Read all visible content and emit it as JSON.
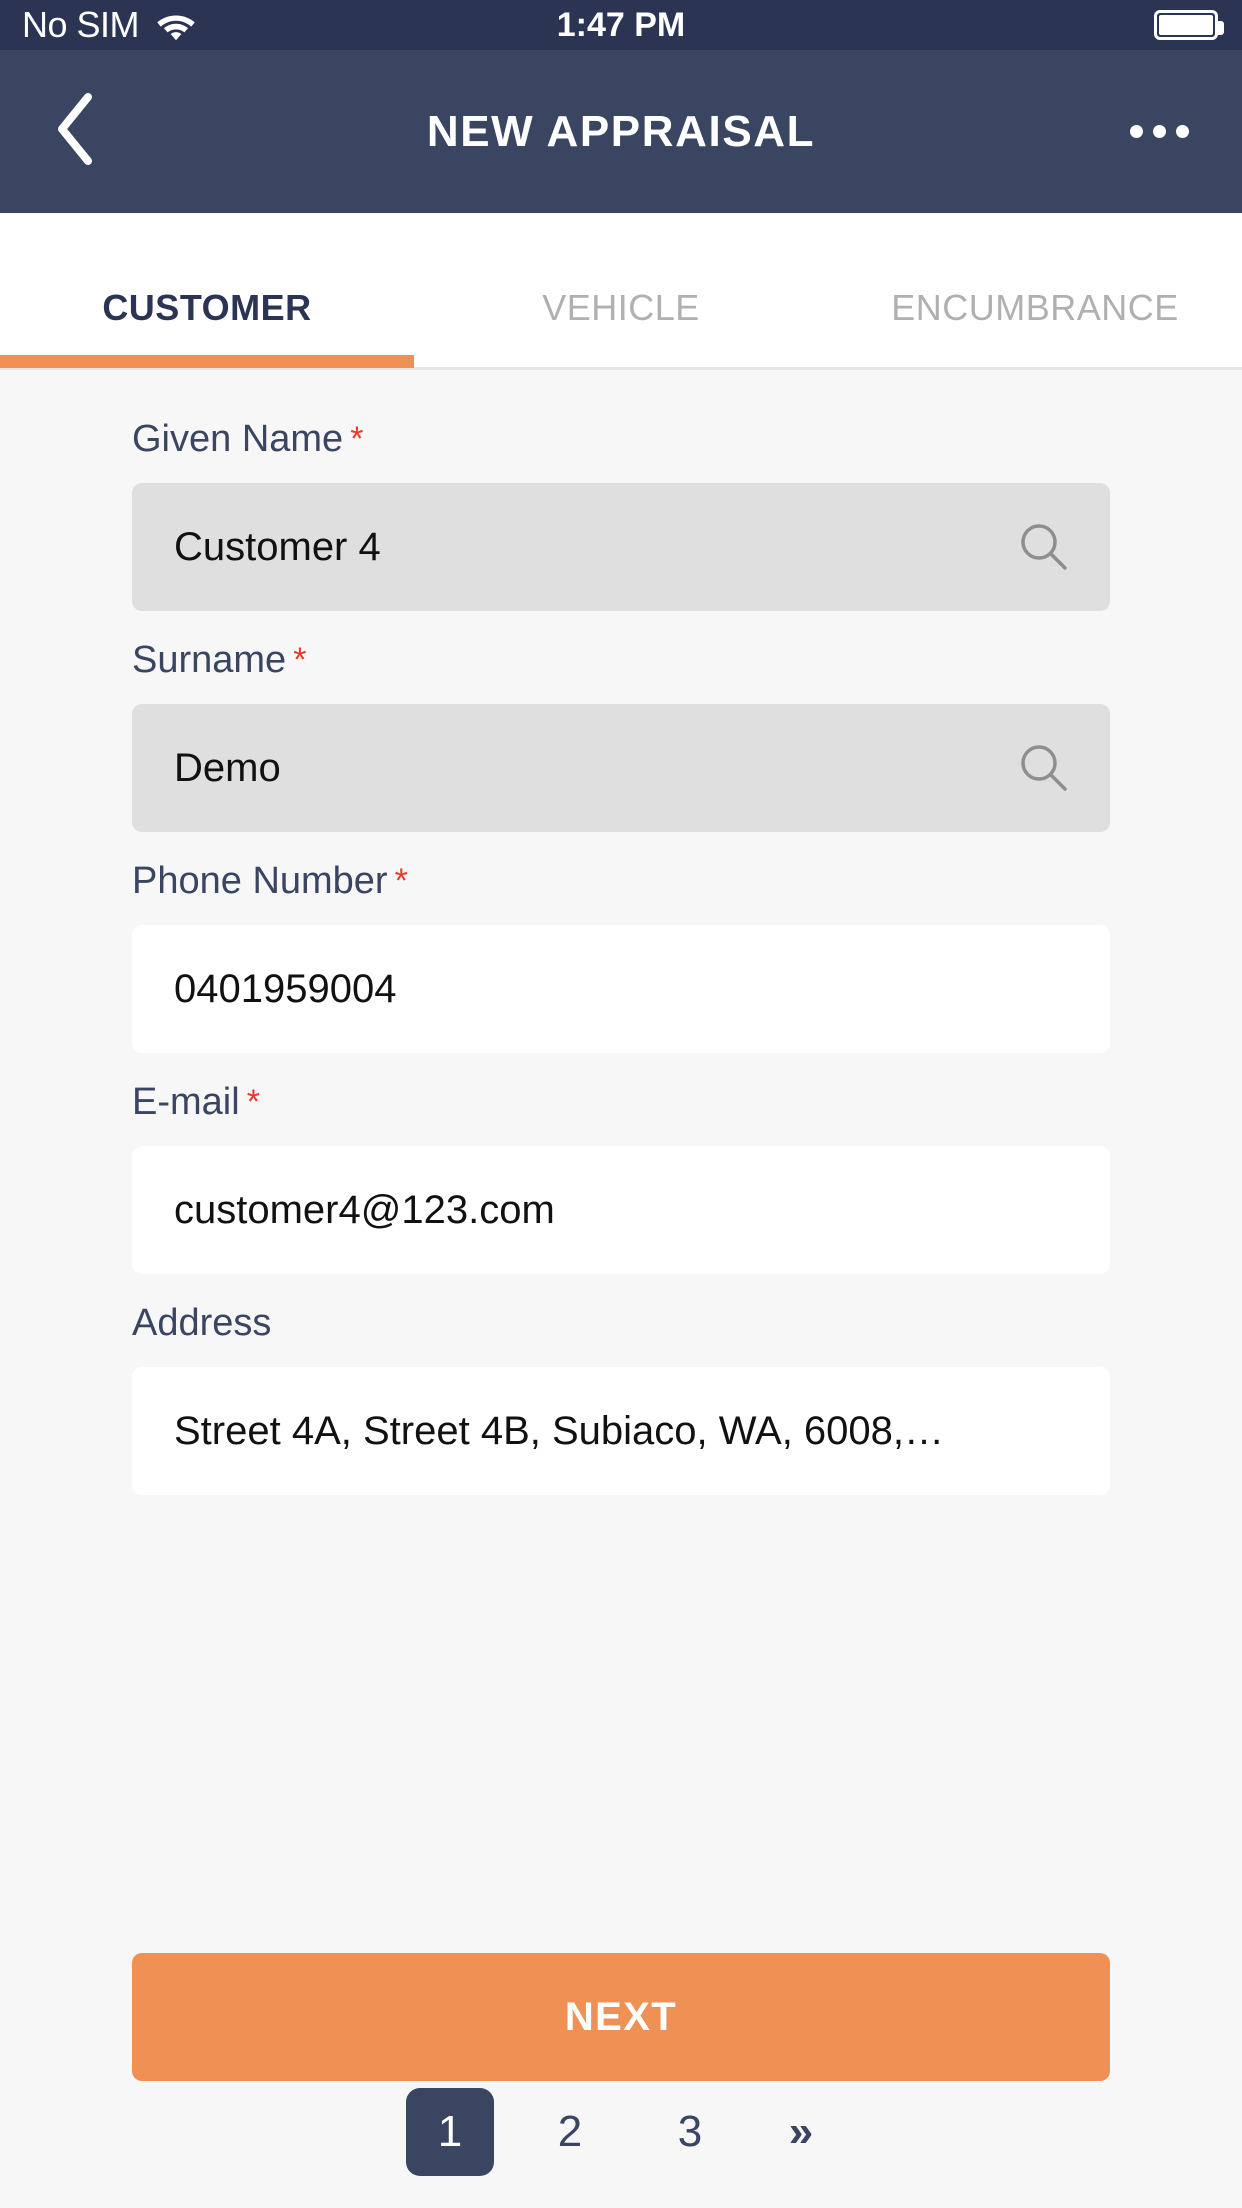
{
  "status_bar": {
    "carrier": "No SIM",
    "wifi_icon": "wifi-icon",
    "time": "1:47 PM",
    "battery_icon": "battery-full-icon"
  },
  "header": {
    "back_icon": "chevron-left-icon",
    "title": "NEW APPRAISAL",
    "more_icon": "ellipsis-icon"
  },
  "tabs": [
    {
      "label": "CUSTOMER",
      "active": true
    },
    {
      "label": "VEHICLE",
      "active": false
    },
    {
      "label": "ENCUMBRANCE",
      "active": false
    }
  ],
  "form": {
    "fields": [
      {
        "label": "Given Name",
        "required": true,
        "value": "Customer 4",
        "placeholder": "Given Name",
        "style": "gray",
        "icon": "search-icon"
      },
      {
        "label": "Surname",
        "required": true,
        "value": "Demo",
        "placeholder": "Surname",
        "style": "gray",
        "icon": "search-icon"
      },
      {
        "label": "Phone Number",
        "required": true,
        "value": "0401959004",
        "placeholder": "Phone Number",
        "style": "white",
        "icon": null
      },
      {
        "label": "E-mail",
        "required": true,
        "value": "customer4@123.com",
        "placeholder": "E-mail",
        "style": "white",
        "icon": null
      },
      {
        "label": "Address",
        "required": false,
        "value": "Street 4A, Street 4B, Subiaco, WA, 6008,…",
        "placeholder": "Address",
        "style": "white",
        "icon": null
      }
    ],
    "required_marker": "*",
    "next_label": "NEXT"
  },
  "pagination": {
    "pages": [
      "1",
      "2",
      "3"
    ],
    "current": "1",
    "next_arrow": "»"
  },
  "colors": {
    "status_bar_bg": "#2b3553",
    "header_bg": "#3a4561",
    "accent_orange": "#ef9154",
    "label_navy": "#3a4561",
    "required_red": "#e8392c",
    "field_gray": "#dfdfdf",
    "field_white": "#ffffff",
    "page_bg": "#f7f7f7",
    "tab_inactive": "#b0b0b0"
  }
}
